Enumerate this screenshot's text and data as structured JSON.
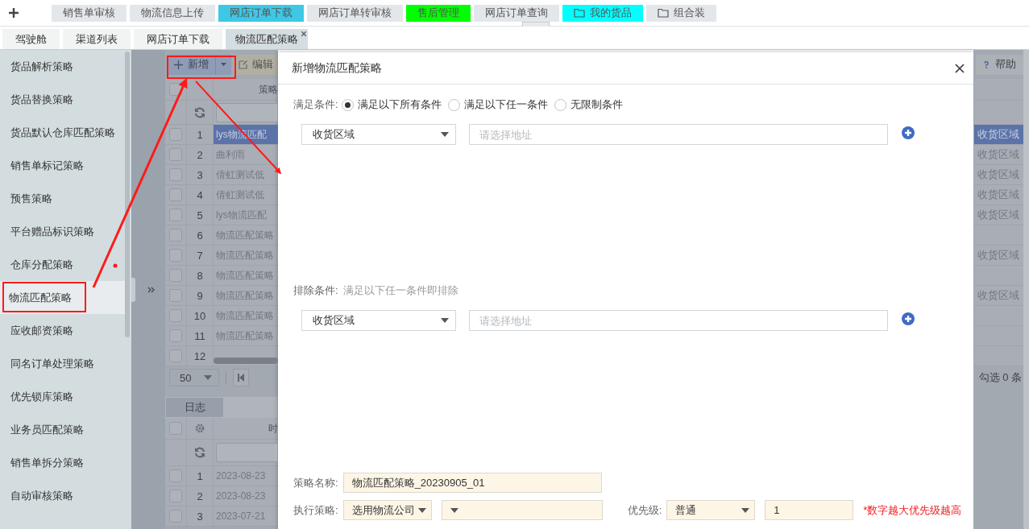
{
  "quick_bar": {
    "items": [
      {
        "label": "销售单审核",
        "kind": "plain",
        "color": "#e4e7ea"
      },
      {
        "label": "物流信息上传",
        "kind": "plain",
        "color": "#e4e7ea"
      },
      {
        "label": "网店订单下载",
        "kind": "plain",
        "color": "#3ec8e6"
      },
      {
        "label": "网店订单转审核",
        "kind": "plain",
        "color": "#e4e7ea"
      },
      {
        "label": "售后管理",
        "kind": "plain",
        "color": "#00ff00"
      },
      {
        "label": "网店订单查询",
        "kind": "plain",
        "color": "#e4e7ea"
      },
      {
        "label": "我的货品",
        "kind": "folder",
        "color": "#00ffff"
      },
      {
        "label": "组合装",
        "kind": "folder",
        "color": "#e4e7ea"
      }
    ]
  },
  "tabs": [
    {
      "label": "驾驶舱",
      "selected": false
    },
    {
      "label": "渠道列表",
      "selected": false
    },
    {
      "label": "网店订单下载",
      "selected": false
    },
    {
      "label": "物流匹配策略",
      "selected": true
    }
  ],
  "sidebar": {
    "items": [
      {
        "label": "货品解析策略",
        "selected": false
      },
      {
        "label": "货品替换策略",
        "selected": false
      },
      {
        "label": "货品默认仓库匹配策略",
        "selected": false
      },
      {
        "label": "销售单标记策略",
        "selected": false
      },
      {
        "label": "预售策略",
        "selected": false
      },
      {
        "label": "平台赠品标识策略",
        "selected": false
      },
      {
        "label": "仓库分配策略",
        "selected": false
      },
      {
        "label": "物流匹配策略",
        "selected": true
      },
      {
        "label": "应收邮资策略",
        "selected": false
      },
      {
        "label": "同名订单处理策略",
        "selected": false
      },
      {
        "label": "优先锁库策略",
        "selected": false
      },
      {
        "label": "业务员匹配策略",
        "selected": false
      },
      {
        "label": "销售单拆分策略",
        "selected": false
      },
      {
        "label": "自动审核策略",
        "selected": false
      }
    ]
  },
  "background": {
    "toolbar": {
      "new_button": "新增",
      "edit_button": "编辑",
      "help_button": "帮助"
    },
    "grid": {
      "column_header": "策略",
      "all_checked": false,
      "rows": [
        {
          "number": "1",
          "checked": false,
          "selected": true,
          "name": "lys物流匹配",
          "column_2": "收货区域"
        },
        {
          "number": "2",
          "checked": false,
          "selected": false,
          "name": "曲利雨",
          "column_2": "收货区域"
        },
        {
          "number": "3",
          "checked": false,
          "selected": false,
          "name": "倩虹测试低",
          "column_2": "收货区域"
        },
        {
          "number": "4",
          "checked": false,
          "selected": false,
          "name": "倩虹测试低",
          "column_2": "收货区域"
        },
        {
          "number": "5",
          "checked": false,
          "selected": false,
          "name": "lys物流匹配",
          "column_2": "收货区域"
        },
        {
          "number": "6",
          "checked": false,
          "selected": false,
          "name": "物流匹配策略"
        },
        {
          "number": "7",
          "checked": false,
          "selected": false,
          "name": "物流匹配策略",
          "column_2": "收货区域"
        },
        {
          "number": "8",
          "checked": false,
          "selected": false,
          "name": "物流匹配策略"
        },
        {
          "number": "9",
          "checked": false,
          "selected": false,
          "name": "物流匹配策略",
          "column_2": "收货区域"
        },
        {
          "number": "10",
          "checked": false,
          "selected": false,
          "name": "物流匹配策略"
        },
        {
          "number": "11",
          "checked": false,
          "selected": false,
          "name": "物流匹配策略"
        },
        {
          "number": "12",
          "checked": false,
          "selected": false
        }
      ]
    },
    "pager": {
      "page_size": "50",
      "selection_count": "勾选 0 条"
    },
    "log": {
      "tab": "日志",
      "column_header": "时",
      "all_checked": false,
      "rows": [
        {
          "number": "1",
          "checked": false,
          "time": "2023-08-23"
        },
        {
          "number": "2",
          "checked": false,
          "time": "2023-08-23"
        },
        {
          "number": "3",
          "checked": false,
          "time": "2023-07-21"
        }
      ]
    }
  },
  "dialog": {
    "title": "新增物流匹配策略",
    "match_label": "满足条件:",
    "match_options": [
      {
        "label": "满足以下所有条件",
        "selected": true
      },
      {
        "label": "满足以下任一条件",
        "selected": false
      },
      {
        "label": "无限制条件",
        "selected": false
      }
    ],
    "match_rule": {
      "field": "收货区域",
      "placeholder": "请选择地址"
    },
    "exclude_label": "排除条件:",
    "exclude_hint": "满足以下任一条件即排除",
    "exclude_rule": {
      "field": "收货区域",
      "placeholder": "请选择地址"
    },
    "name_label": "策略名称:",
    "name_value": "物流匹配策略_20230905_01",
    "execute_label": "执行策略:",
    "execute_mode": "选用物流公司",
    "priority_label": "优先级:",
    "priority_level": "普通",
    "priority_value": "1",
    "priority_note": "*数字越大优先级越高"
  }
}
